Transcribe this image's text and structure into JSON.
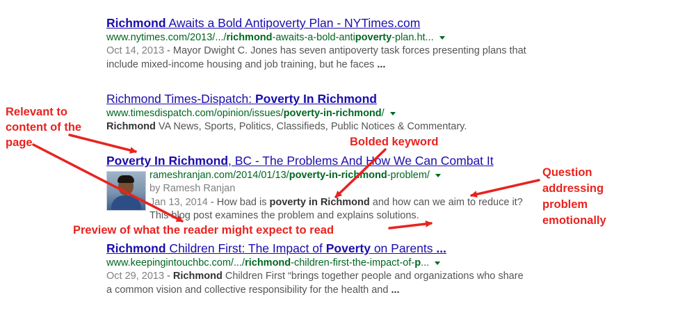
{
  "results": [
    {
      "title": {
        "b1": "Richmond",
        "t1": " Awaits a Bold Antipoverty Plan - NYTimes.com"
      },
      "url": {
        "p1": "www.nytimes.com/2013/.../",
        "b1": "richmond",
        "p2": "-awaits-a-bold-anti",
        "b2": "poverty",
        "p3": "-plan.ht..."
      },
      "snippet": {
        "date": "Oct 14, 2013",
        "t1": " - Mayor Dwight C. Jones has seven antipoverty task forces presenting plans that include mixed-income housing and job training, but he faces ",
        "b1": "..."
      }
    },
    {
      "title": {
        "t1": "Richmond Times-Dispatch: ",
        "b1": "Poverty In Richmond"
      },
      "url": {
        "p1": "www.timesdispatch.com/opinion/issues/",
        "b1": "poverty-in-richmond",
        "p2": "/"
      },
      "snippet": {
        "b1": "Richmond",
        "t1": " VA News, Sports, Politics, Classifieds, Public Notices & Commentary."
      }
    },
    {
      "title": {
        "b1": "Poverty In Richmond",
        "t1": ", BC - The Problems And How We Can Combat It"
      },
      "url": {
        "p1": "rameshranjan.com/2014/01/13/",
        "b1": "poverty-in-richmond",
        "p2": "-problem/"
      },
      "author": "by Ramesh Ranjan",
      "thumb_alt": "Ramesh Ranjan photo",
      "snippet": {
        "date": "Jan 13, 2014",
        "t1": " - How bad is ",
        "b1": "poverty in Richmond",
        "t2": " and how can we aim to reduce it? This blog post examines the problem and explains solutions."
      }
    },
    {
      "title": {
        "b1": "Richmond",
        "t1": " Children First: The Impact of ",
        "b2": "Poverty",
        "t2": " on Parents ",
        "b3": "..."
      },
      "url": {
        "p1": "www.keepingintouchbc.com/.../",
        "b1": "richmond",
        "p2": "-children-first-the-impact-of-",
        "b2": "p",
        "p3": "..."
      },
      "snippet": {
        "date": "Oct 29, 2013",
        "t1": " - ",
        "b1": "Richmond",
        "t2": " Children First “brings together people and organizations who share a common vision and collective responsibility for the health and ",
        "b2": "..."
      }
    }
  ],
  "annotations": {
    "relevant": [
      "Relevant to",
      "content of the",
      "page"
    ],
    "bolded": "Bolded keyword",
    "question": [
      "Question",
      "addressing",
      "problem",
      "emotionally"
    ],
    "preview": "Preview of what the reader might expect to read"
  },
  "colors": {
    "link": "#1a0dab",
    "url": "#006621",
    "snippet": "#545454",
    "annotation": "#e8231f"
  }
}
